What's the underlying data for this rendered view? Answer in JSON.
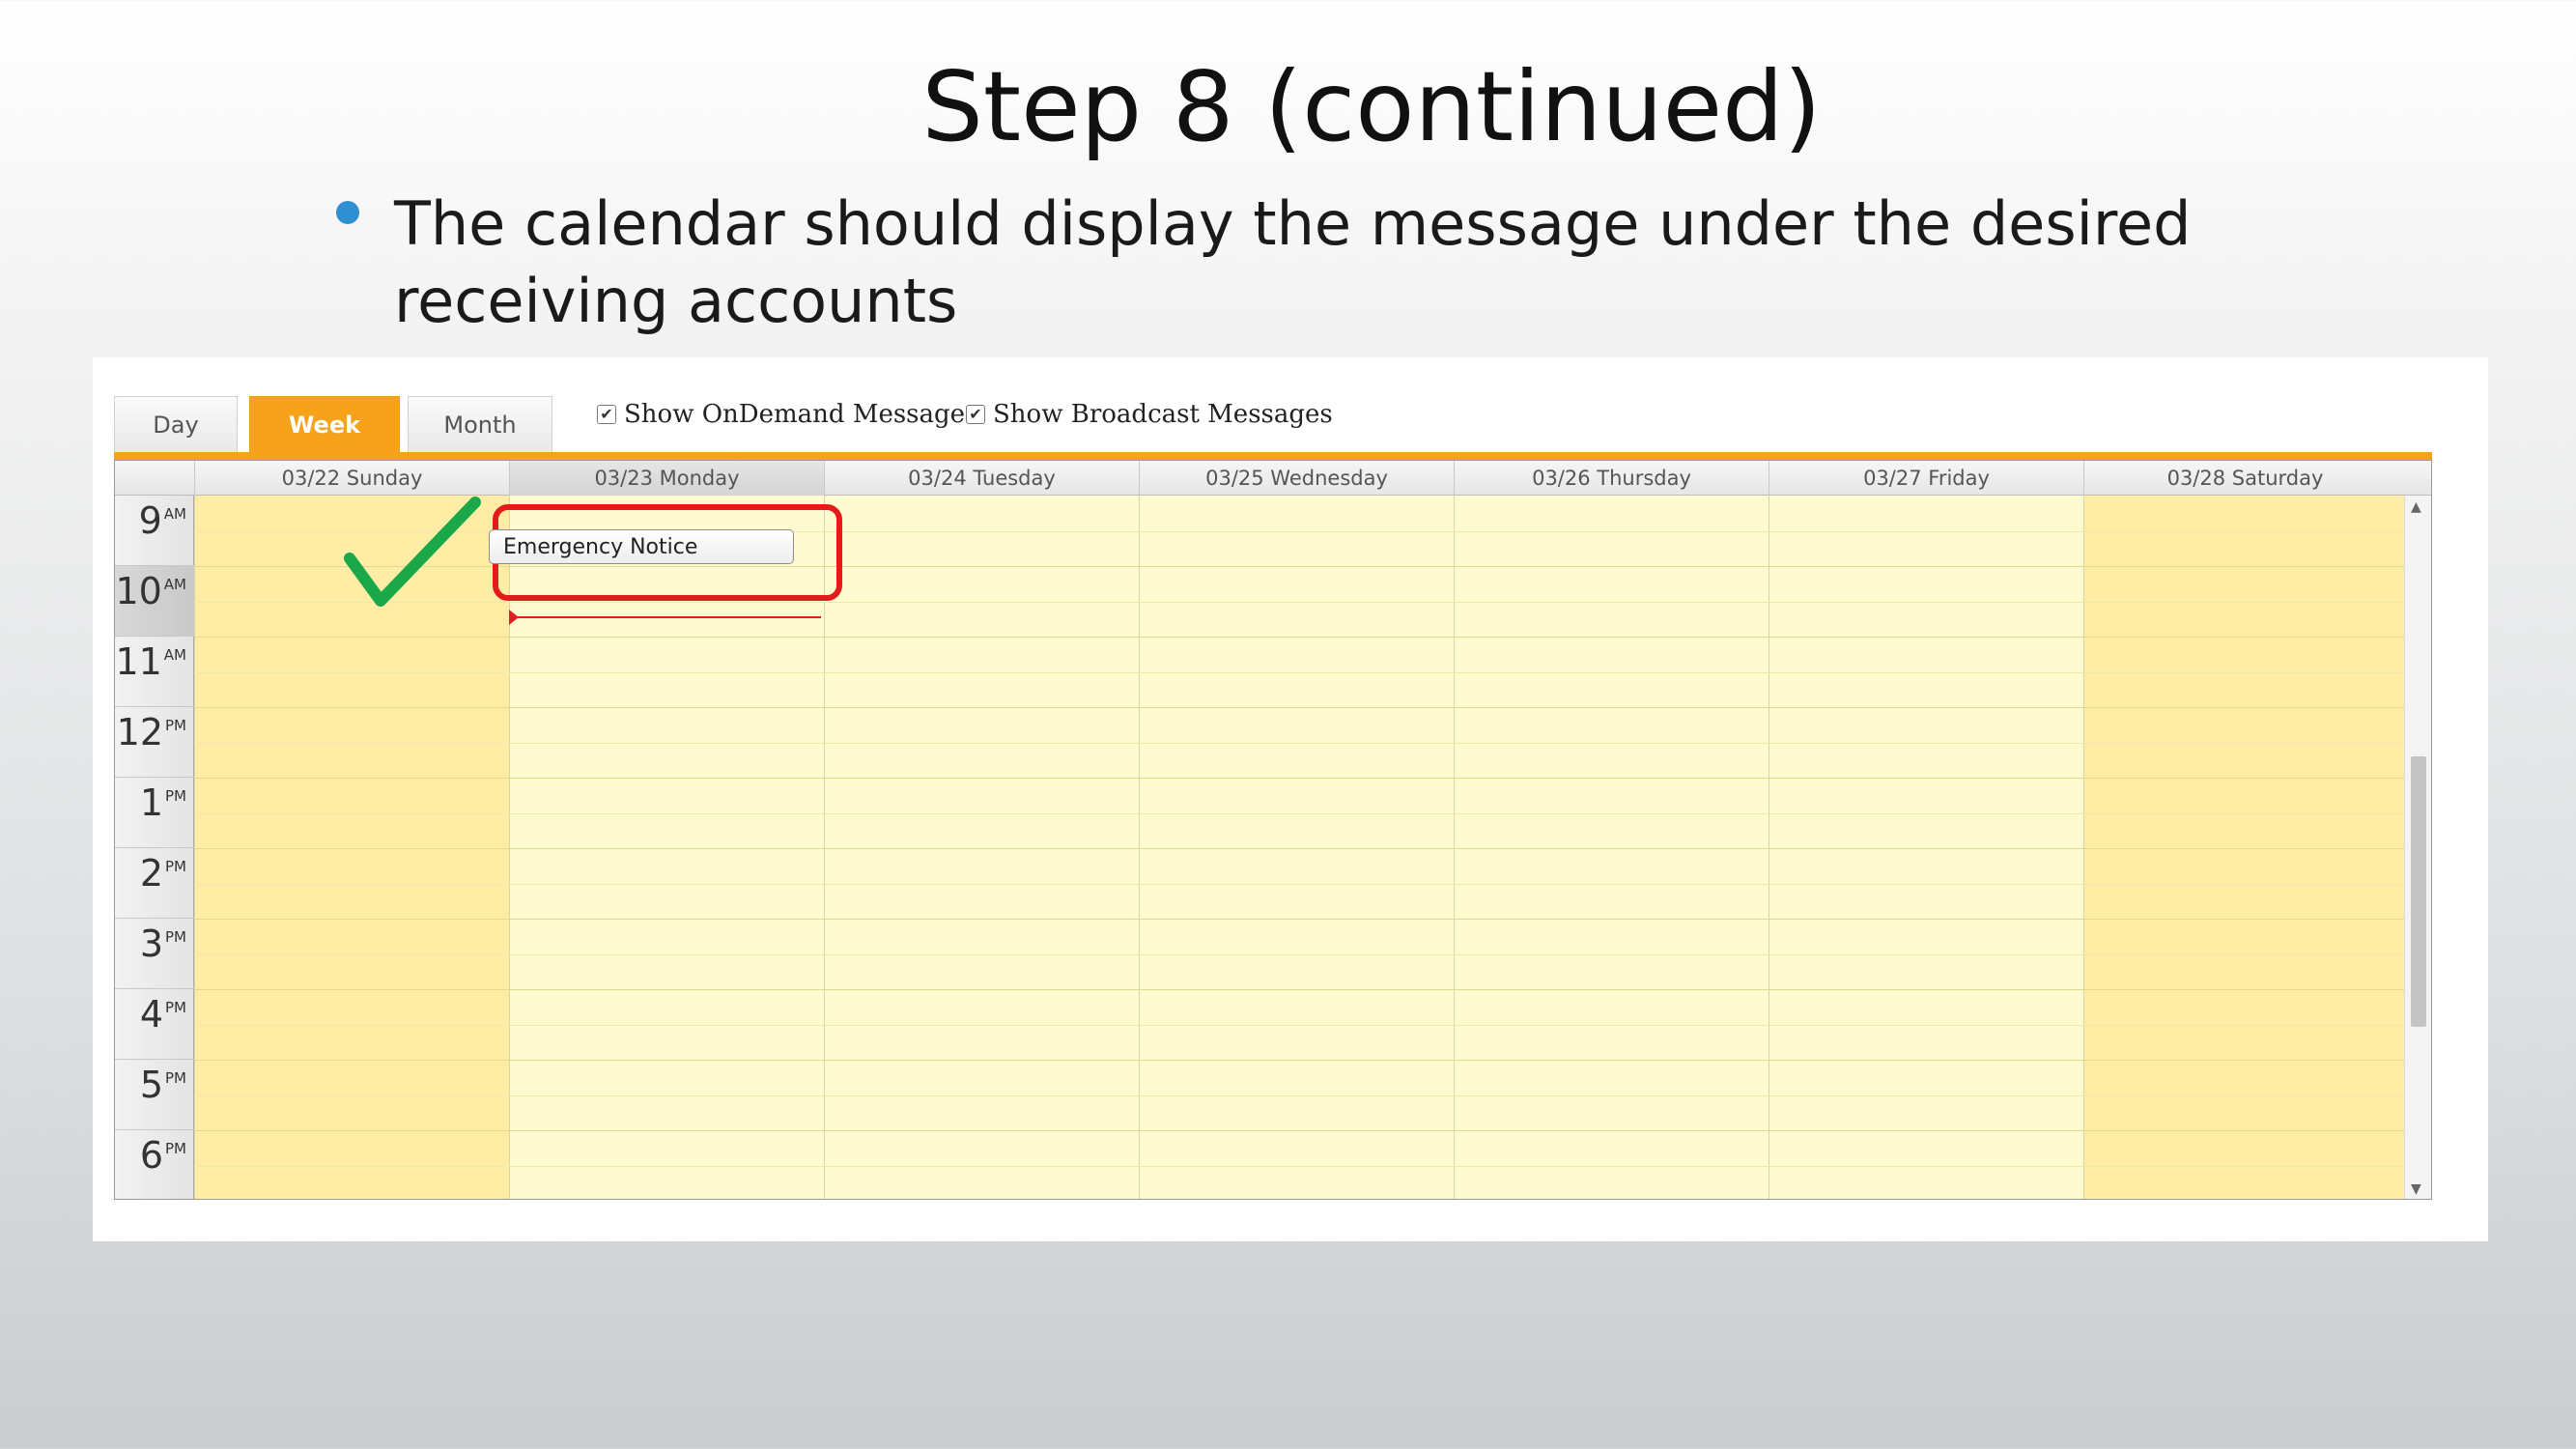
{
  "slide": {
    "title": "Step 8 (continued)",
    "bullet": "The calendar should display the message under the desired receiving accounts"
  },
  "tabs": [
    {
      "label": "Day",
      "active": false
    },
    {
      "label": "Week",
      "active": true
    },
    {
      "label": "Month",
      "active": false
    }
  ],
  "filters": {
    "ondemand_label": "Show OnDemand Messages",
    "ondemand_checked": true,
    "broadcast_label": "Show Broadcast Messages",
    "broadcast_checked": true
  },
  "calendar": {
    "days": [
      "03/22 Sunday",
      "03/23 Monday",
      "03/24 Tuesday",
      "03/25 Wednesday",
      "03/26 Thursday",
      "03/27 Friday",
      "03/28 Saturday"
    ],
    "selected_day": "03/23 Monday",
    "hours": [
      {
        "hr": "9",
        "ap": "AM"
      },
      {
        "hr": "10",
        "ap": "AM"
      },
      {
        "hr": "11",
        "ap": "AM"
      },
      {
        "hr": "12",
        "ap": "PM"
      },
      {
        "hr": "1",
        "ap": "PM"
      },
      {
        "hr": "2",
        "ap": "PM"
      },
      {
        "hr": "3",
        "ap": "PM"
      },
      {
        "hr": "4",
        "ap": "PM"
      },
      {
        "hr": "5",
        "ap": "PM"
      },
      {
        "hr": "6",
        "ap": "PM"
      }
    ],
    "event": {
      "title": "Emergency Notice",
      "day": "03/23 Monday"
    }
  },
  "colors": {
    "accent": "#f7a21b",
    "highlight": "#e31b1b",
    "checkmark": "#1aa84a",
    "weekday_bg": "#fffbd0",
    "weekend_bg": "#ffeda6"
  },
  "icons": {
    "check": "check-mark-icon",
    "checkbox": "checkbox-checked-icon",
    "scroll_up": "scroll-up-arrow-icon",
    "scroll_down": "scroll-down-arrow-icon"
  }
}
